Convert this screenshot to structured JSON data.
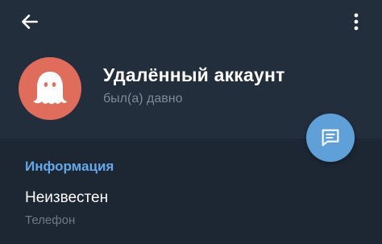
{
  "header": {
    "back_icon": "arrow-left-icon",
    "menu_icon": "more-vertical-icon",
    "background_color": "#232e3c"
  },
  "profile": {
    "name": "Удалённый аккаунт",
    "status": "был(а) давно",
    "avatar_icon": "ghost-icon",
    "avatar_color": "#e06c5c"
  },
  "fab": {
    "icon": "message-icon",
    "color": "#5fa0d9"
  },
  "info": {
    "title": "Информация",
    "items": [
      {
        "value": "Неизвестен",
        "label": "Телефон"
      }
    ]
  }
}
